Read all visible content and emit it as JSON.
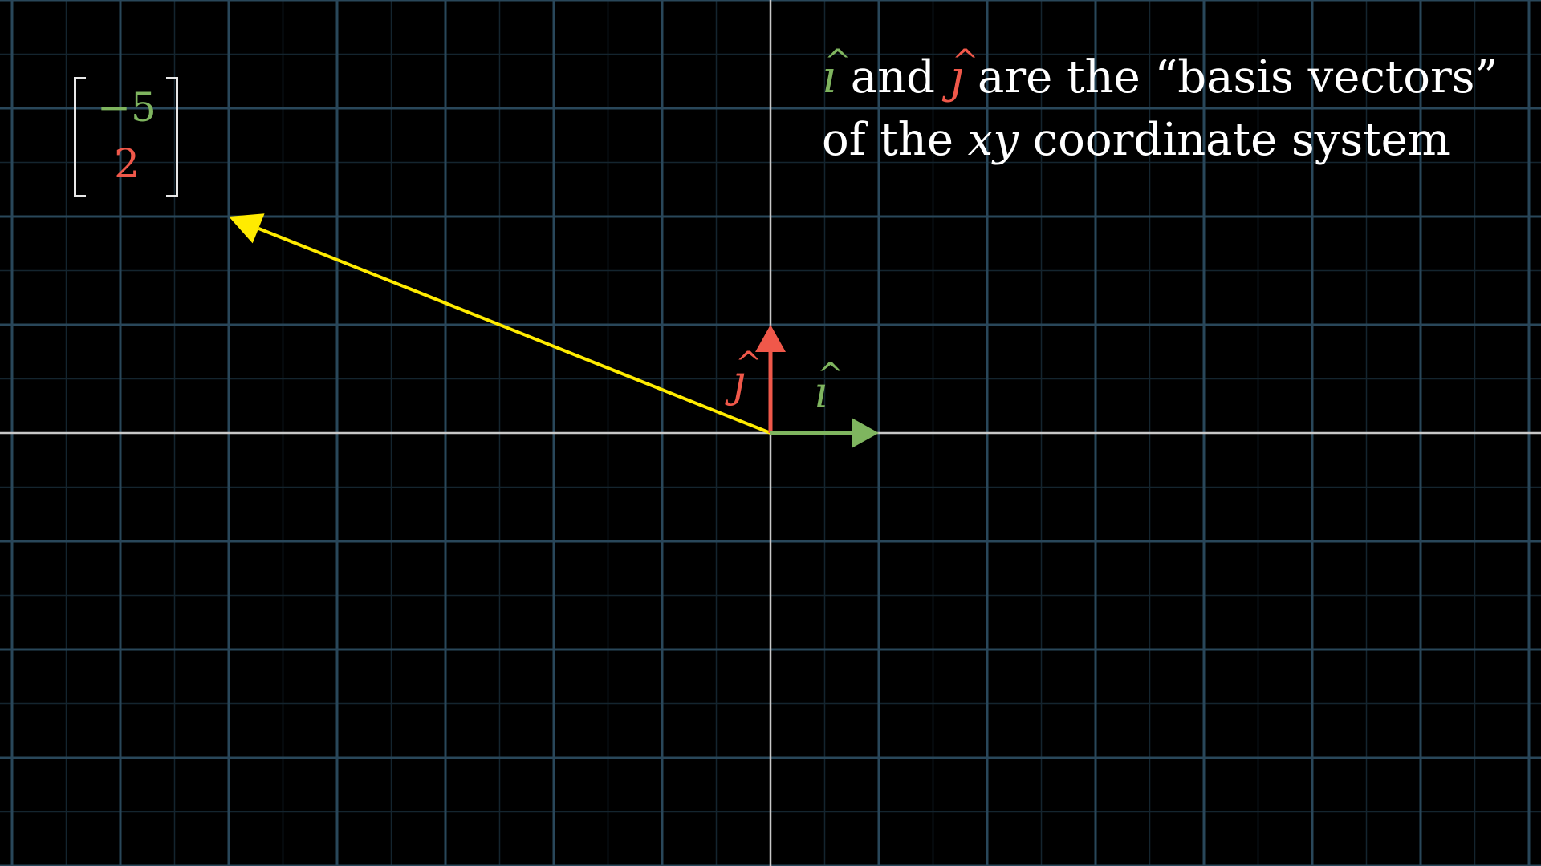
{
  "colors": {
    "background": "#000000",
    "grid_major": "#29475a",
    "grid_minor": "#14252f",
    "axis": "#c8c8c8",
    "vector": "#ffeb00",
    "i_hat": "#7fb55f",
    "j_hat": "#f0584a",
    "text": "#ffffff"
  },
  "plane": {
    "x_range": [
      -7,
      7
    ],
    "y_range": [
      -4,
      4
    ],
    "minor_step": 0.5
  },
  "vector": {
    "x": -5,
    "y": 2
  },
  "column_vector": {
    "x_entry": "−5",
    "y_entry": "2"
  },
  "basis": {
    "i_hat": {
      "x": 1,
      "y": 0,
      "letter": "ı",
      "hat": "^"
    },
    "j_hat": {
      "x": 0,
      "y": 1,
      "letter": "ȷ",
      "hat": "^"
    }
  },
  "caption": {
    "i_sym": "ı",
    "j_sym": "ȷ",
    "hat": "^",
    "line1_and": " and ",
    "line1_rest": " are the “basis vectors”",
    "line2_pre": "of the ",
    "line2_var": "xy",
    "line2_post": " coordinate system"
  }
}
